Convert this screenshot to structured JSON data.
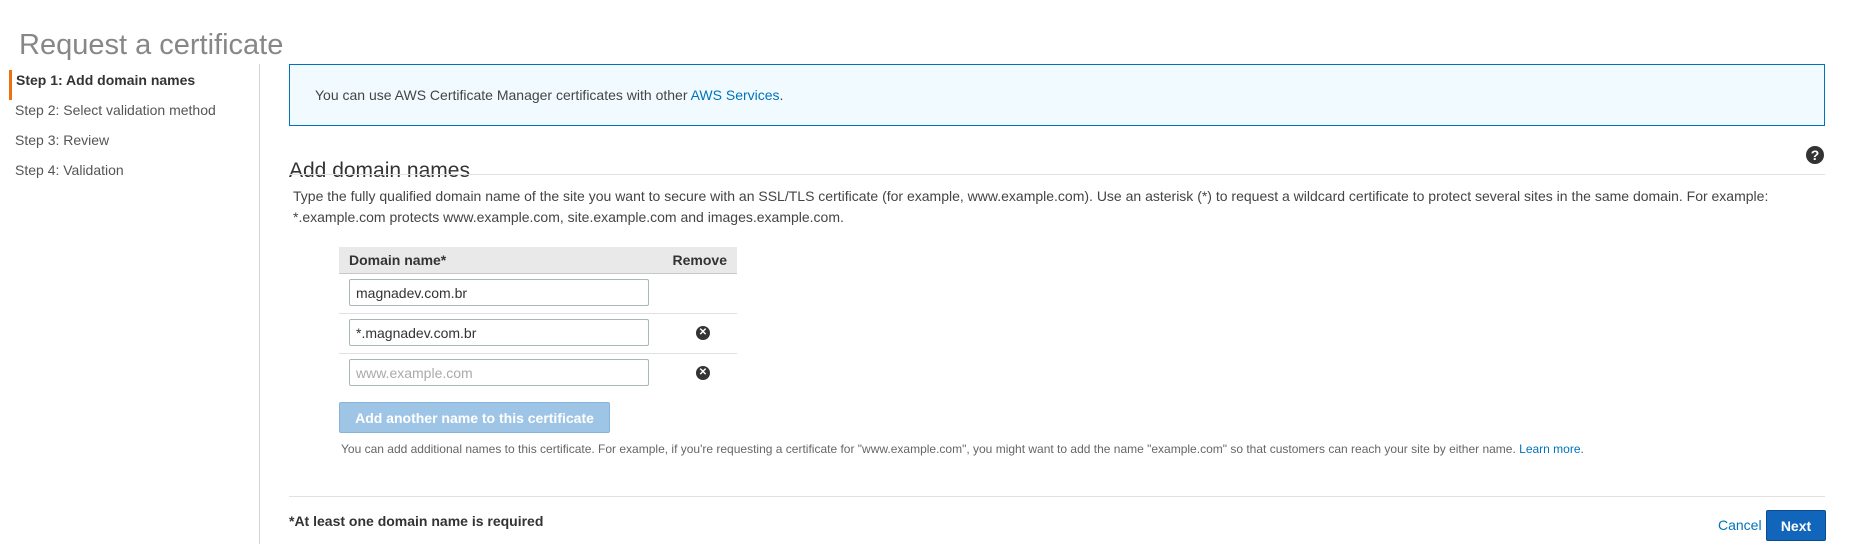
{
  "page": {
    "title": "Request a certificate"
  },
  "steps": [
    {
      "label": "Step 1: Add domain names",
      "active": true
    },
    {
      "label": "Step 2: Select validation method",
      "active": false
    },
    {
      "label": "Step 3: Review",
      "active": false
    },
    {
      "label": "Step 4: Validation",
      "active": false
    }
  ],
  "info": {
    "text": "You can use AWS Certificate Manager certificates with other ",
    "link": "AWS Services",
    "suffix": "."
  },
  "section": {
    "title": "Add domain names",
    "help_icon": "question-circle-icon",
    "description": "Type the fully qualified domain name of the site you want to secure with an SSL/TLS certificate (for example, www.example.com). Use an asterisk (*) to request a wildcard certificate to protect several sites in the same domain. For example: *.example.com protects www.example.com, site.example.com and images.example.com."
  },
  "table": {
    "col_domain": "Domain name*",
    "col_remove": "Remove",
    "rows": [
      {
        "value": "magnadev.com.br",
        "placeholder": "",
        "removable": false
      },
      {
        "value": "*.magnadev.com.br",
        "placeholder": "",
        "removable": true
      },
      {
        "value": "",
        "placeholder": "www.example.com",
        "removable": true
      }
    ],
    "remove_icon": "times-circle-icon"
  },
  "add_button": {
    "label": "Add another name to this certificate"
  },
  "hint": {
    "text": "You can add additional names to this certificate. For example, if you're requesting a certificate for \"www.example.com\", you might want to add the name \"example.com\" so that customers can reach your site by either name. ",
    "link": "Learn more."
  },
  "footer": {
    "required_note": "*At least one domain name is required",
    "cancel_label": "Cancel",
    "next_label": "Next"
  },
  "colors": {
    "accent": "#0073bb",
    "active_step": "#ec7211",
    "info_bg": "#f1faff",
    "primary_button": "#1166bb",
    "disabled_button": "#9ec5e6"
  }
}
